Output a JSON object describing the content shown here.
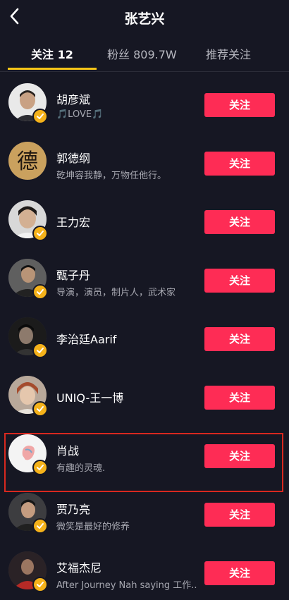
{
  "header": {
    "title": "张艺兴",
    "back_icon": "chevron-left-icon"
  },
  "tabs": [
    {
      "label": "关注 12",
      "active": true
    },
    {
      "label": "粉丝 809.7W",
      "active": false
    },
    {
      "label": "推荐关注",
      "active": false
    }
  ],
  "follow_label": "关注",
  "accent": "#fe2c55",
  "underline_color": "#f5c518",
  "users": [
    {
      "name": "胡彦斌",
      "desc": "🎵LOVE🎵",
      "verified": true
    },
    {
      "name": "郭德纲",
      "desc": "乾坤容我静，万物任他行。",
      "verified": false
    },
    {
      "name": "王力宏",
      "desc": "",
      "verified": true
    },
    {
      "name": "甄子丹",
      "desc": "导演，演员，制片人，武术家",
      "verified": true
    },
    {
      "name": "李治廷Aarif",
      "desc": "",
      "verified": true
    },
    {
      "name": "UNIQ-王一博",
      "desc": "",
      "verified": true
    },
    {
      "name": "肖战",
      "desc": "有趣的灵魂.",
      "verified": true,
      "highlighted": true
    },
    {
      "name": "贾乃亮",
      "desc": "微笑是最好的修养",
      "verified": true
    },
    {
      "name": "艾福杰尼",
      "desc": "After Journey  Nah saying 工作...",
      "verified": true
    }
  ]
}
